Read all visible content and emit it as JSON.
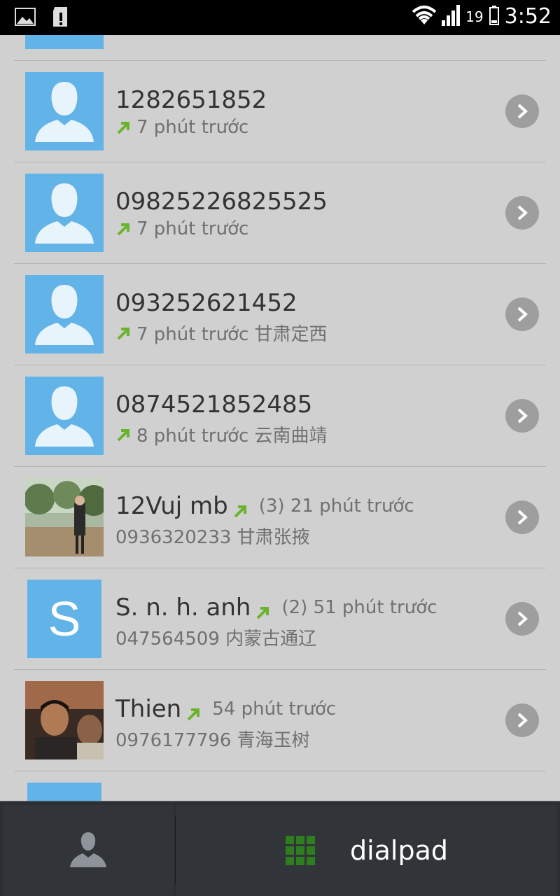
{
  "status_bar": {
    "time": "3:52",
    "battery_level": "19",
    "icons": [
      "image-icon",
      "sd-card-alert-icon",
      "wifi-icon",
      "signal-icon",
      "battery-icon"
    ]
  },
  "colors": {
    "avatar_blue": "#62b3e8",
    "outgoing_arrow": "#6ab42d",
    "chevron_bg": "#9e9e9e"
  },
  "calls": [
    {
      "title": "1282651852",
      "meta": "",
      "sub": "7 phút trước",
      "avatar": "default"
    },
    {
      "title": "09825226825525",
      "meta": "",
      "sub": "7 phút trước",
      "avatar": "default"
    },
    {
      "title": "093252621452",
      "meta": "",
      "sub": "7 phút trước 甘肃定西",
      "avatar": "default"
    },
    {
      "title": "0874521852485",
      "meta": "",
      "sub": "8 phút trước 云南曲靖",
      "avatar": "default"
    },
    {
      "title": "12Vuj mb",
      "meta": "(3) 21 phút trước",
      "sub": "0936320233 甘肃张掖",
      "avatar": "photo"
    },
    {
      "title": "S. n. h. anh",
      "meta": "(2) 51 phút trước",
      "sub": "047564509 内蒙古通辽",
      "avatar": "letter",
      "letter": "S"
    },
    {
      "title": "Thien",
      "meta": "54 phút trước",
      "sub": "0976177796 青海玉树",
      "avatar": "photo"
    }
  ],
  "bottom_bar": {
    "dialpad_label": "dialpad"
  }
}
